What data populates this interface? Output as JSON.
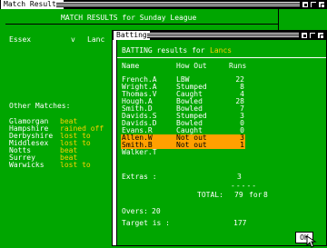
{
  "results_window": {
    "title": "Match Results",
    "heading": "MATCH RESULTS for Sunday League",
    "home_team": "Essex",
    "versus": "v",
    "away_team_fragment": "Lanc",
    "other_matches_label": "Other Matches:",
    "other_matches": [
      {
        "team": "Glamorgan",
        "result": "beat"
      },
      {
        "team": "Hampshire",
        "result": "rained off"
      },
      {
        "team": "Derbyshire",
        "result": "lost to"
      },
      {
        "team": "Middlesex",
        "result": "lost to"
      },
      {
        "team": "Notts",
        "result": "beat"
      },
      {
        "team": "Surrey",
        "result": "beat"
      },
      {
        "team": "Warwicks",
        "result": "lost to"
      }
    ]
  },
  "batting_window": {
    "title": "Batting",
    "heading_prefix": "BATTING results for",
    "team": "Lancs",
    "columns": {
      "name": "Name",
      "how_out": "How Out",
      "runs": "Runs"
    },
    "rows": [
      {
        "name": "French.A",
        "how_out": "LBW",
        "runs": "22",
        "highlight": false
      },
      {
        "name": "Wright.A",
        "how_out": "Stumped",
        "runs": "8",
        "highlight": false
      },
      {
        "name": "Thomas.V",
        "how_out": "Caught",
        "runs": "4",
        "highlight": false
      },
      {
        "name": "Hough.A",
        "how_out": "Bowled",
        "runs": "28",
        "highlight": false
      },
      {
        "name": "Smith.D",
        "how_out": "Bowled",
        "runs": "7",
        "highlight": false
      },
      {
        "name": "Davids.S",
        "how_out": "Stumped",
        "runs": "3",
        "highlight": false
      },
      {
        "name": "Davids.D",
        "how_out": "Bowled",
        "runs": "0",
        "highlight": false
      },
      {
        "name": "Evans.R",
        "how_out": "Caught",
        "runs": "0",
        "highlight": false
      },
      {
        "name": "Allen.W",
        "how_out": "Not out",
        "runs": "3",
        "highlight": true
      },
      {
        "name": "Smith.B",
        "how_out": "Not out",
        "runs": "1",
        "highlight": true
      },
      {
        "name": "Walker.T",
        "how_out": "",
        "runs": "",
        "highlight": false
      }
    ],
    "extras_label": "Extras :",
    "extras_value": "3",
    "total_label": "TOTAL:",
    "total_runs": "79",
    "total_for": "for",
    "total_wickets": "8",
    "overs_label": "Overs:",
    "overs_value": "20",
    "target_label": "Target is :",
    "target_value": "177"
  },
  "ok_button": "OK"
}
